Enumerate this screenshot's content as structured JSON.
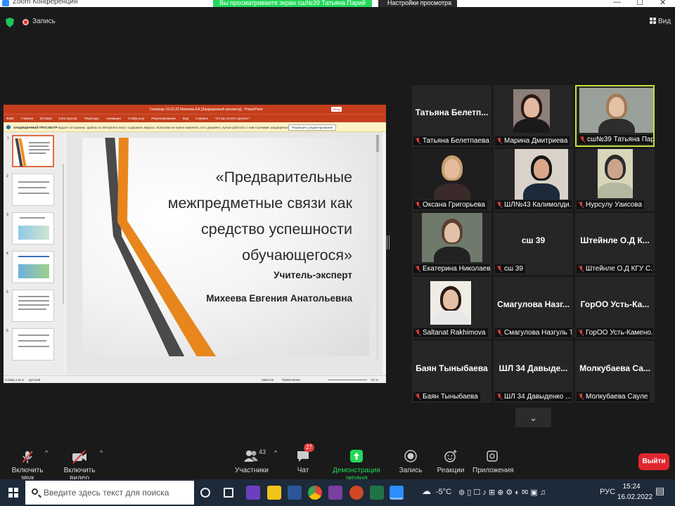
{
  "window": {
    "title": "Zoom Конференция"
  },
  "share_banner": "Вы просматриваете экран сш№39 Татьяна Парий",
  "view_options": "Настройки просмотра",
  "recording": {
    "label": "Запись"
  },
  "view_button": "Вид",
  "powerpoint": {
    "doc_title": "Семинар 16.02.22 Михеева ЕА [Защищенный просмотр] - PowerPoint",
    "login": "Вход",
    "ribbon_tabs": [
      "Файл",
      "Главная",
      "Вставка",
      "Конструктор",
      "Переходы",
      "Анимация",
      "Слайд-шоу",
      "Рецензирование",
      "Вид",
      "Справка",
      "Что вы хотите сделать?"
    ],
    "protected_label": "ЗАЩИЩЕННЫЙ ПРОСМОТР",
    "protected_msg": "Будьте осторожны: файлы из Интернета могут содержать вирусы. Если вам не нужно изменять этот документ, лучше работать с ним в режиме защищенного просмотра.",
    "enable_editing": "Разрешить редактирование",
    "thumb_numbers": [
      "1",
      "2",
      "3",
      "4",
      "5",
      "6"
    ],
    "slide": {
      "title": "«Предварительные межпредметные связи как средство успешности обучающегося»",
      "role": "Учитель-эксперт",
      "author": "Михеева Евгения Анатольевна"
    },
    "status": {
      "slide": "Слайд 1 из 6",
      "lang": "русский",
      "notes": "Заметки",
      "comments": "Примечания",
      "zoom": "54 %"
    }
  },
  "participants": [
    {
      "big": "Татьяна Белетп...",
      "name": "Татьяна Белетпаева",
      "video": false
    },
    {
      "big": "",
      "name": "Марина Дмитриева",
      "video": true
    },
    {
      "big": "",
      "name": "сш№39 Татьяна Парий",
      "video": true,
      "active": true
    },
    {
      "big": "",
      "name": "Оксана Григорьева",
      "video": true
    },
    {
      "big": "",
      "name": "ШЛ№43 Калимолди...",
      "video": true
    },
    {
      "big": "",
      "name": "Нурсулу Уаисова",
      "video": true
    },
    {
      "big": "",
      "name": "Екатерина Николаев...",
      "video": true
    },
    {
      "big": "сш 39",
      "name": "сш 39",
      "video": false
    },
    {
      "big": "Штейнле О.Д К...",
      "name": "Штейнле О.Д КГУ С...",
      "video": false
    },
    {
      "big": "",
      "name": "Saltanat Rakhimova",
      "video": true
    },
    {
      "big": "Смагулова Назг...",
      "name": "Смагулова Назгуль Т...",
      "video": false
    },
    {
      "big": "ГорОО Усть-Ка...",
      "name": "ГорОО Усть-Камено...",
      "video": false
    },
    {
      "big": "Баян Тыныбаева",
      "name": "Баян Тыныбаева",
      "video": false
    },
    {
      "big": "ШЛ 34 Давыде...",
      "name": "ШЛ 34 Давыденко ...",
      "video": false
    },
    {
      "big": "Молкубаева Са...",
      "name": "Молкубаева Сауле",
      "video": false
    }
  ],
  "toolbar": {
    "unmute": "Включить звук",
    "start_video": "Включить видео",
    "participants": "Участники",
    "participants_count": "43",
    "chat": "Чат",
    "chat_badge": "27",
    "share": "Демонстрация экрана",
    "record": "Запись",
    "reactions": "Реакции",
    "apps": "Приложения",
    "leave": "Выйти"
  },
  "taskbar": {
    "search_placeholder": "Введите здесь текст для поиска",
    "weather": "-5°C",
    "lang": "РУС",
    "time": "15:24",
    "date": "16.02.2022"
  }
}
